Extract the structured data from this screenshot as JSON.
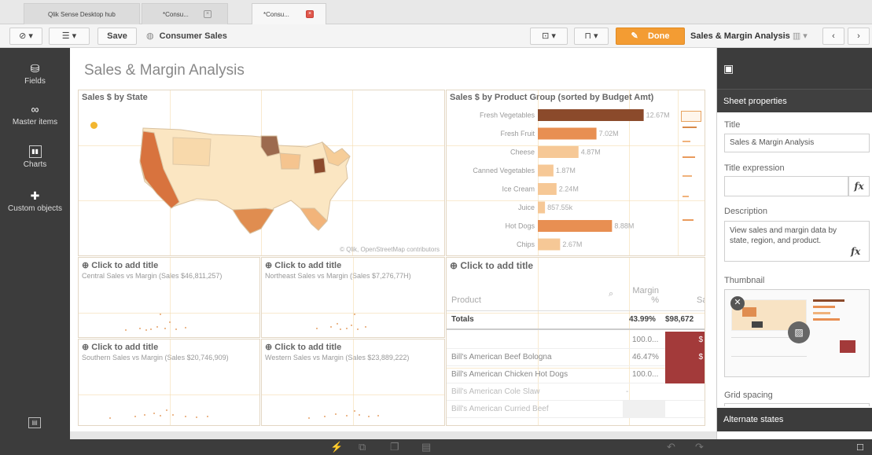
{
  "tabs": [
    {
      "label": "Qlik Sense Desktop hub"
    },
    {
      "label": "*Consu..."
    },
    {
      "label": "*Consu..."
    }
  ],
  "toolbar": {
    "save_label": "Save",
    "app_name": "Consumer Sales",
    "done_label": "Done",
    "sheet_selector": "Sales & Margin Analysis"
  },
  "leftrail": {
    "items": [
      {
        "label": "Fields",
        "icon": "database-icon"
      },
      {
        "label": "Master items",
        "icon": "link-icon"
      },
      {
        "label": "Charts",
        "icon": "chart-icon"
      },
      {
        "label": "Custom objects",
        "icon": "puzzle-icon"
      }
    ]
  },
  "sheet": {
    "title": "Sales & Margin Analysis",
    "map_panel": {
      "title": "Sales $ by State",
      "attribution": "© Qlik, OpenStreetMap contributors"
    },
    "bar_panel": {
      "title": "Sales $ by Product Group (sorted by Budget Amt)"
    },
    "scatter_panels": [
      {
        "title": "Click to add title",
        "subtitle": "Central Sales vs Margin (Sales $46,811,257)"
      },
      {
        "title": "Click to add title",
        "subtitle": "Northeast Sales vs Margin (Sales $7,276,77H)"
      },
      {
        "title": "Click to add title",
        "subtitle": "Southern Sales vs Margin (Sales $20,746,909)"
      },
      {
        "title": "Click to add title",
        "subtitle": "Western Sales vs Margin (Sales $23,889,222)"
      }
    ],
    "table_panel": {
      "title": "Click to add title",
      "col_product": "Product",
      "col_margin": "Margin %",
      "col_sales": "Sa",
      "totals_label": "Totals",
      "totals_margin": "43.99%",
      "totals_sales": "$98,672",
      "rows": [
        {
          "product": "",
          "margin": "100.0...",
          "sales": "$"
        },
        {
          "product": "Bill's American Beef Bologna",
          "margin": "46.47%",
          "sales": "$"
        },
        {
          "product": "Bill's American Chicken Hot Dogs",
          "margin": "100.0...",
          "sales": ""
        },
        {
          "product": "Bill's American Cole Slaw",
          "margin": "-",
          "sales": ""
        },
        {
          "product": "Bill's American Curried Beef",
          "margin": "",
          "sales": ""
        }
      ]
    }
  },
  "chart_data": {
    "type": "bar",
    "title": "Sales $ by Product Group (sorted by Budget Amt)",
    "categories": [
      "Fresh Vegetables",
      "Fresh Fruit",
      "Cheese",
      "Canned Vegetables",
      "Ice Cream",
      "Juice",
      "Hot Dogs",
      "Chips"
    ],
    "values": [
      12.67,
      7.02,
      4.87,
      1.87,
      2.24,
      0.857,
      8.88,
      2.67
    ],
    "data_labels": [
      "12.67M",
      "7.02M",
      "4.87M",
      "1.87M",
      "2.24M",
      "857.55k",
      "8.88M",
      "2.67M"
    ],
    "xlim": [
      0,
      16
    ]
  },
  "rightpanel": {
    "header_icon": "sheet-icon",
    "section_title": "Sheet properties",
    "title_label": "Title",
    "title_value": "Sales & Margin Analysis",
    "title_expression_label": "Title expression",
    "fx_label": "fx",
    "description_label": "Description",
    "description_value": "View sales and margin data by state, region, and product.",
    "thumbnail_label": "Thumbnail",
    "grid_spacing_label": "Grid spacing",
    "alternate_states_label": "Alternate states"
  },
  "colors": {
    "accent": "#f39c33",
    "dark": "#3c3c3c",
    "bar_dark": "#8b4a2b",
    "bar_mid": "#e88f52",
    "bar_light": "#f6c896",
    "table_red": "#a33a3a"
  }
}
